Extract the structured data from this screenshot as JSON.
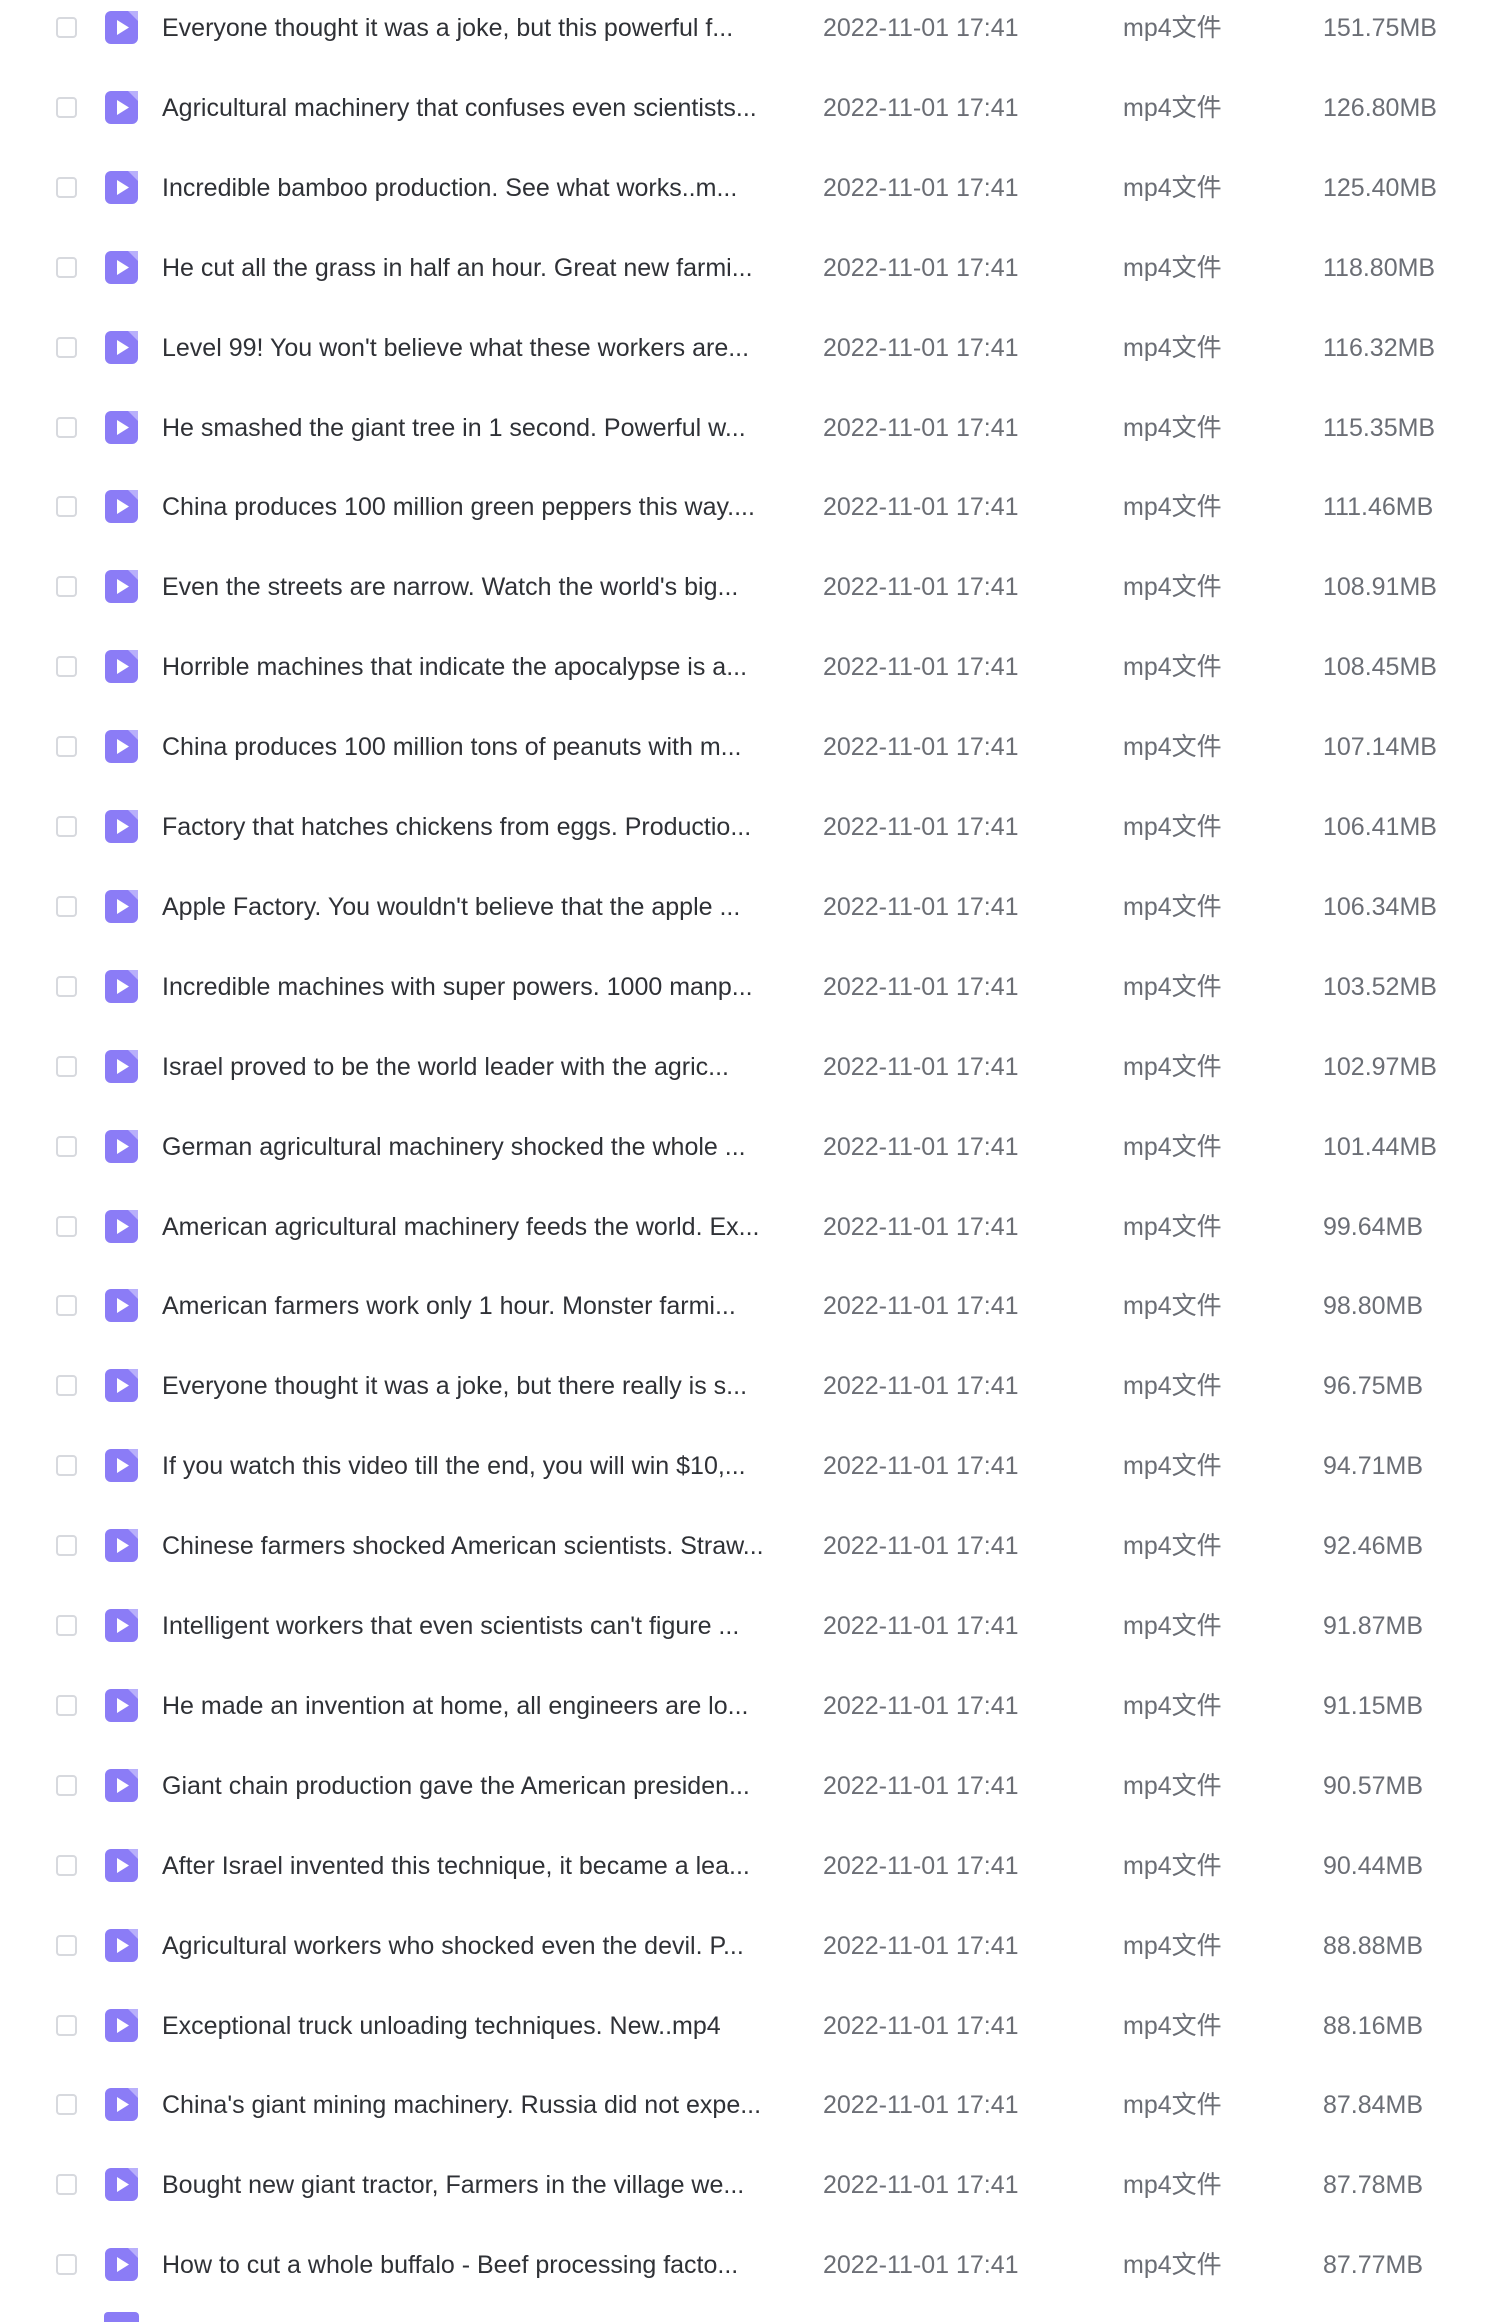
{
  "icon": "video-file-icon",
  "colors": {
    "icon_bg": "#8b7cf6",
    "icon_fold": "#b9b0fb",
    "checkbox_border": "#d7d9de",
    "name_text": "#2f3136",
    "meta_text": "#6b6e75"
  },
  "files": [
    {
      "name": "Everyone thought it was a joke, but this powerful f...",
      "date": "2022-11-01 17:41",
      "type": "mp4文件",
      "size": "151.75MB"
    },
    {
      "name": "Agricultural machinery that confuses even scientists...",
      "date": "2022-11-01 17:41",
      "type": "mp4文件",
      "size": "126.80MB"
    },
    {
      "name": "Incredible bamboo production. See what works..m...",
      "date": "2022-11-01 17:41",
      "type": "mp4文件",
      "size": "125.40MB"
    },
    {
      "name": "He cut all the grass in half an hour. Great new farmi...",
      "date": "2022-11-01 17:41",
      "type": "mp4文件",
      "size": "118.80MB"
    },
    {
      "name": "Level 99! You won't believe what these workers are...",
      "date": "2022-11-01 17:41",
      "type": "mp4文件",
      "size": "116.32MB"
    },
    {
      "name": "He smashed the giant tree in 1 second. Powerful w...",
      "date": "2022-11-01 17:41",
      "type": "mp4文件",
      "size": "115.35MB"
    },
    {
      "name": "China produces 100 million green peppers this way....",
      "date": "2022-11-01 17:41",
      "type": "mp4文件",
      "size": "111.46MB"
    },
    {
      "name": "Even the streets are narrow. Watch the world's big...",
      "date": "2022-11-01 17:41",
      "type": "mp4文件",
      "size": "108.91MB"
    },
    {
      "name": "Horrible machines that indicate the apocalypse is a...",
      "date": "2022-11-01 17:41",
      "type": "mp4文件",
      "size": "108.45MB"
    },
    {
      "name": "China produces 100 million tons of peanuts with m...",
      "date": "2022-11-01 17:41",
      "type": "mp4文件",
      "size": "107.14MB"
    },
    {
      "name": "Factory that hatches chickens from eggs. Productio...",
      "date": "2022-11-01 17:41",
      "type": "mp4文件",
      "size": "106.41MB"
    },
    {
      "name": "Apple Factory. You wouldn't believe that the apple ...",
      "date": "2022-11-01 17:41",
      "type": "mp4文件",
      "size": "106.34MB"
    },
    {
      "name": "Incredible machines with super powers. 1000 manp...",
      "date": "2022-11-01 17:41",
      "type": "mp4文件",
      "size": "103.52MB"
    },
    {
      "name": "Israel proved to be the world leader with the agric...",
      "date": "2022-11-01 17:41",
      "type": "mp4文件",
      "size": "102.97MB"
    },
    {
      "name": "German agricultural machinery shocked the whole ...",
      "date": "2022-11-01 17:41",
      "type": "mp4文件",
      "size": "101.44MB"
    },
    {
      "name": "American agricultural machinery feeds the world. Ex...",
      "date": "2022-11-01 17:41",
      "type": "mp4文件",
      "size": "99.64MB"
    },
    {
      "name": "American farmers work only 1 hour. Monster farmi...",
      "date": "2022-11-01 17:41",
      "type": "mp4文件",
      "size": "98.80MB"
    },
    {
      "name": "Everyone thought it was a joke, but there really is s...",
      "date": "2022-11-01 17:41",
      "type": "mp4文件",
      "size": "96.75MB"
    },
    {
      "name": "If you watch this video till the end, you will win $10,...",
      "date": "2022-11-01 17:41",
      "type": "mp4文件",
      "size": "94.71MB"
    },
    {
      "name": "Chinese farmers shocked American scientists. Straw...",
      "date": "2022-11-01 17:41",
      "type": "mp4文件",
      "size": "92.46MB"
    },
    {
      "name": "Intelligent workers that even scientists can't figure ...",
      "date": "2022-11-01 17:41",
      "type": "mp4文件",
      "size": "91.87MB"
    },
    {
      "name": "He made an invention at home, all engineers are lo...",
      "date": "2022-11-01 17:41",
      "type": "mp4文件",
      "size": "91.15MB"
    },
    {
      "name": "Giant chain production gave the American presiden...",
      "date": "2022-11-01 17:41",
      "type": "mp4文件",
      "size": "90.57MB"
    },
    {
      "name": "After Israel invented this technique, it became a lea...",
      "date": "2022-11-01 17:41",
      "type": "mp4文件",
      "size": "90.44MB"
    },
    {
      "name": "Agricultural workers who shocked even the devil. P...",
      "date": "2022-11-01 17:41",
      "type": "mp4文件",
      "size": "88.88MB"
    },
    {
      "name": "Exceptional truck unloading techniques. New..mp4",
      "date": "2022-11-01 17:41",
      "type": "mp4文件",
      "size": "88.16MB"
    },
    {
      "name": "China's giant mining machinery. Russia did not expe...",
      "date": "2022-11-01 17:41",
      "type": "mp4文件",
      "size": "87.84MB"
    },
    {
      "name": "Bought new giant tractor, Farmers in the village we...",
      "date": "2022-11-01 17:41",
      "type": "mp4文件",
      "size": "87.78MB"
    },
    {
      "name": "How to cut a whole buffalo - Beef processing facto...",
      "date": "2022-11-01 17:41",
      "type": "mp4文件",
      "size": "87.77MB"
    }
  ]
}
